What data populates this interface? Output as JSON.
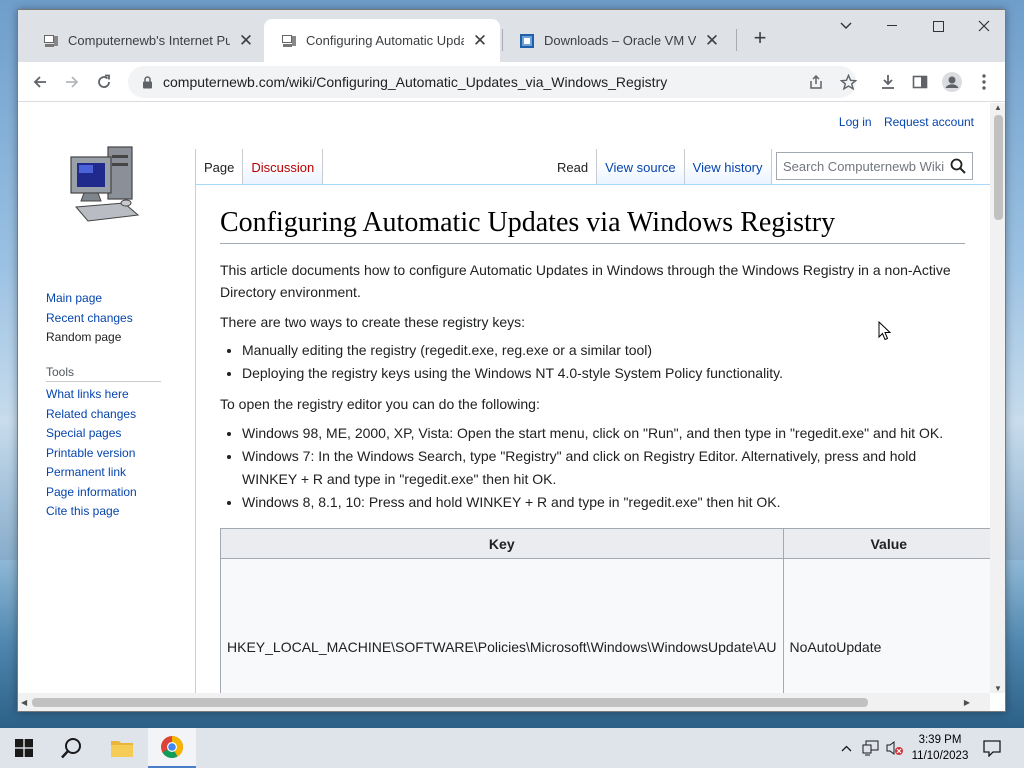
{
  "browser": {
    "tabs": [
      {
        "title": "Computernewb's Internet Pub H",
        "active": false
      },
      {
        "title": "Configuring Automatic Updates",
        "active": true
      },
      {
        "title": "Downloads – Oracle VM VirtualB",
        "active": false
      }
    ],
    "url": "computernewb.com/wiki/Configuring_Automatic_Updates_via_Windows_Registry"
  },
  "page": {
    "user_links": {
      "login": "Log in",
      "request": "Request account"
    },
    "tabs_left": [
      "Page",
      "Discussion"
    ],
    "tabs_right": [
      "Read",
      "View source",
      "View history"
    ],
    "search_placeholder": "Search Computernewb Wiki",
    "title": "Configuring Automatic Updates via Windows Registry",
    "intro": "This article documents how to configure Automatic Updates in Windows through the Windows Registry in a non-Active Directory environment.",
    "ways_intro": "There are two ways to create these registry keys:",
    "ways": [
      "Manually editing the registry (regedit.exe, reg.exe or a similar tool)",
      "Deploying the registry keys using the Windows NT 4.0-style System Policy functionality."
    ],
    "open_intro": "To open the registry editor you can do the following:",
    "open_steps": [
      "Windows 98, ME, 2000, XP, Vista: Open the start menu, click on \"Run\", and then type in \"regedit.exe\" and hit OK.",
      "Windows 7: In the Windows Search, type \"Registry\" and click on Registry Editor. Alternatively, press and hold WINKEY + R and type in \"regedit.exe\" then hit OK.",
      "Windows 8, 8.1, 10: Press and hold WINKEY + R and type in \"regedit.exe\" then hit OK."
    ],
    "table": {
      "headers": [
        "Key",
        "Value"
      ],
      "rows": [
        [
          "HKEY_LOCAL_MACHINE\\SOFTWARE\\Policies\\Microsoft\\Windows\\WindowsUpdate\\AU",
          "NoAutoUpdate"
        ]
      ]
    }
  },
  "sidebar": {
    "nav": [
      "Main page",
      "Recent changes",
      "Random page"
    ],
    "tools_heading": "Tools",
    "tools": [
      "What links here",
      "Related changes",
      "Special pages",
      "Printable version",
      "Permanent link",
      "Page information",
      "Cite this page"
    ]
  },
  "taskbar": {
    "time": "3:39 PM",
    "date": "11/10/2023"
  }
}
